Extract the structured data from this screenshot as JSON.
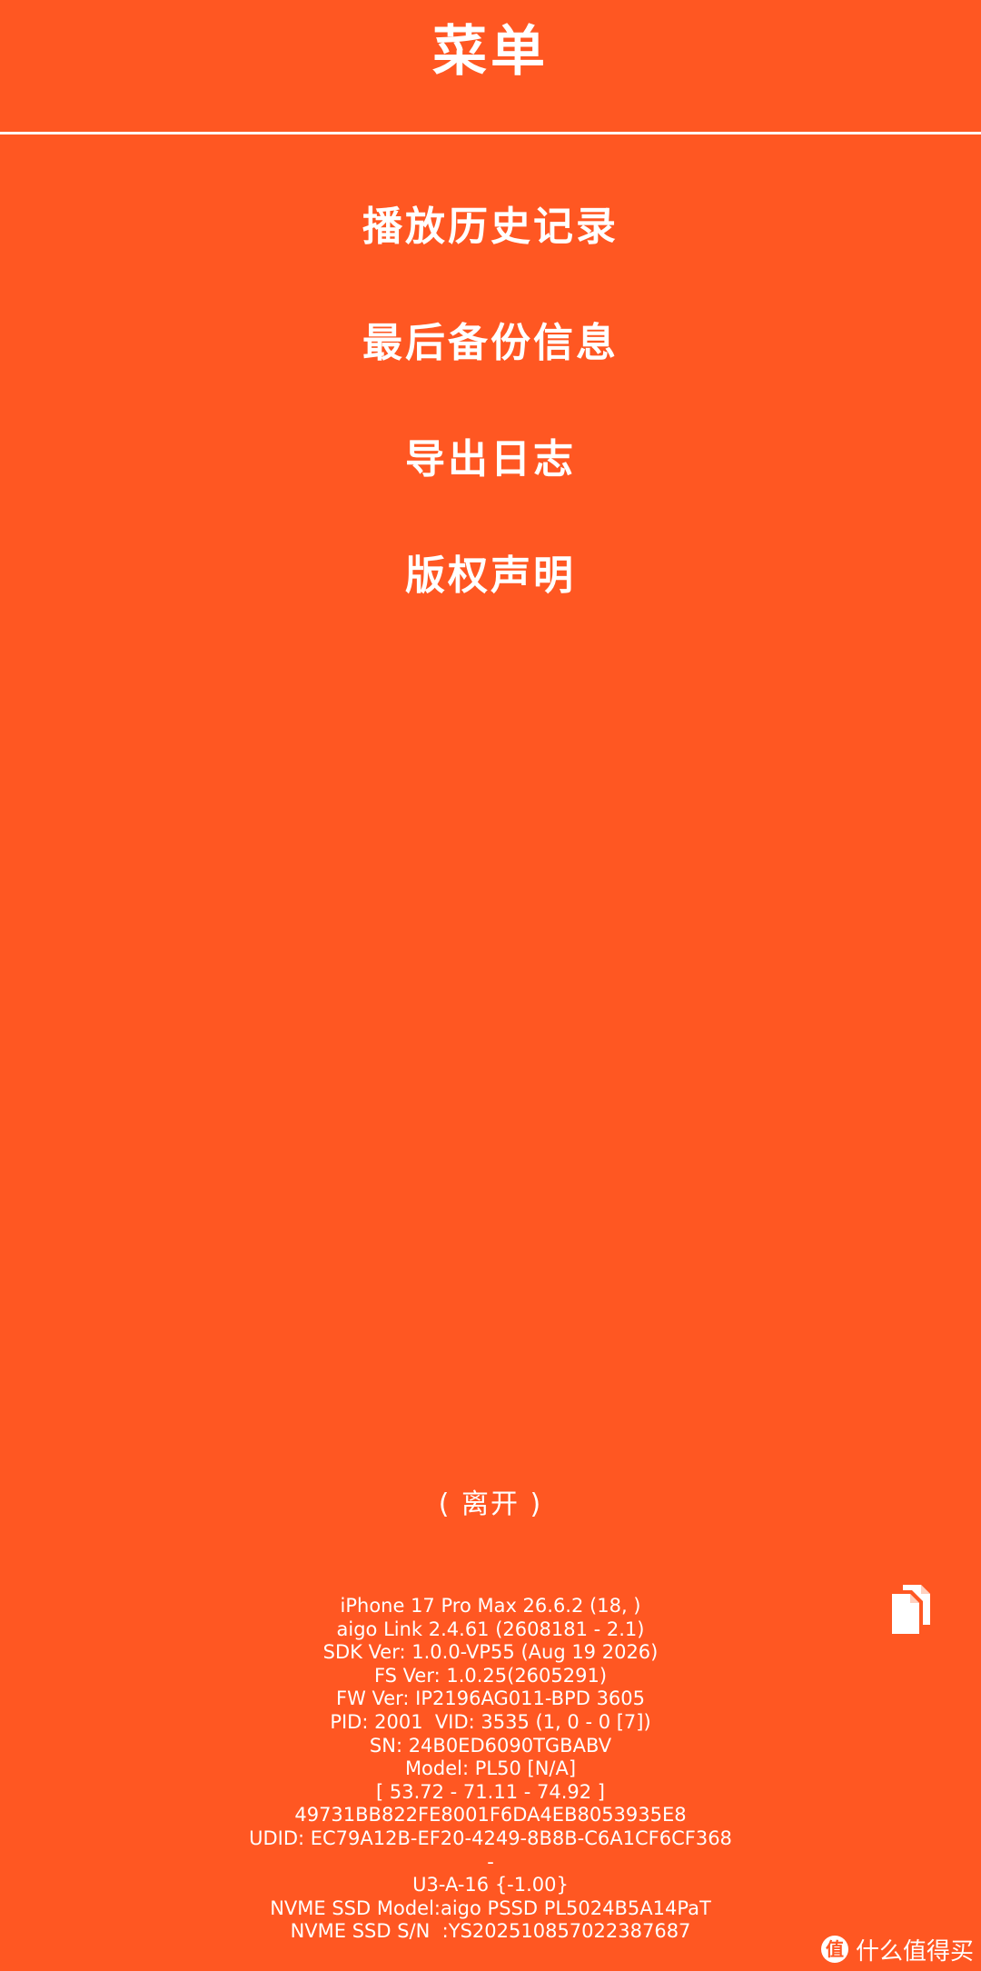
{
  "header": {
    "title": "菜单"
  },
  "menu": {
    "items": [
      {
        "label": "播放历史记录"
      },
      {
        "label": "最后备份信息"
      },
      {
        "label": "导出日志"
      },
      {
        "label": "版权声明"
      }
    ]
  },
  "leave_label": "( 离开 )",
  "copy_icon": "copy-icon",
  "info": {
    "lines": [
      "iPhone 17 Pro Max 26.6.2 (18, )",
      "aigo Link 2.4.61 (2608181 - 2.1)",
      "SDK Ver: 1.0.0-VP55 (Aug 19 2026)",
      "FS Ver: 1.0.25(2605291)",
      "FW Ver: IP2196AG011-BPD 3605",
      "PID: 2001  VID: 3535 (1, 0 - 0 [7])",
      "SN: 24B0ED6090TGBABV",
      "Model: PL50 [N/A]",
      "[ 53.72 - 71.11 - 74.92 ]",
      "49731BB822FE8001F6DA4EB8053935E8",
      "UDID: EC79A12B-EF20-4249-8B8B-C6A1CF6CF368",
      "-",
      "U3-A-16 {-1.00}",
      "NVME SSD Model:aigo PSSD PL5024B5A14PaT",
      "NVME SSD S/N  :YS202510857022387687"
    ]
  },
  "watermark": {
    "badge": "值",
    "text": "什么值得买"
  },
  "colors": {
    "background": "#ff5722",
    "foreground": "#ffffff"
  }
}
